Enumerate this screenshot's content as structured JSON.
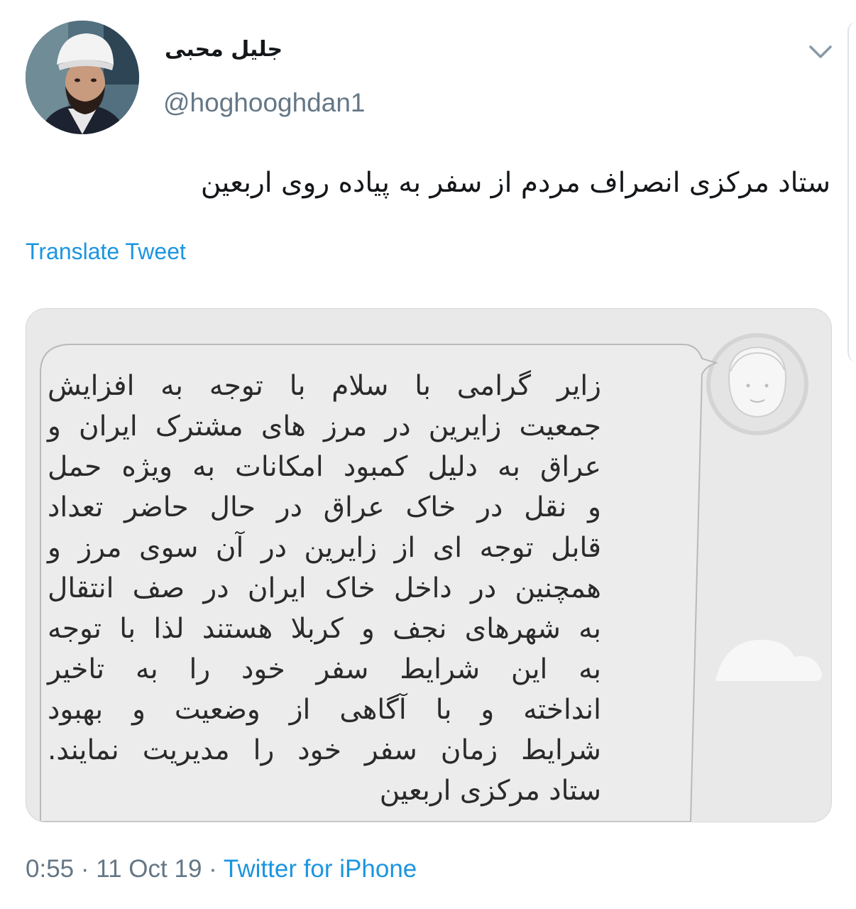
{
  "author": {
    "display_name": "جلیل محبی",
    "handle": "@hoghooghdan1",
    "avatar_icon": "profile-photo"
  },
  "menu_icon": "chevron-down-icon",
  "tweet": {
    "text": "ستاد مرکزی انصراف مردم از سفر به پیاده روی اربعین",
    "translate_label": "Translate Tweet"
  },
  "media": {
    "avatar_icon": "default-user-icon",
    "message_lines": [
      "زایر گرامی با سلام با توجه به افزایش",
      "جمعیت زایرین در مرز های مشترک ایران و",
      "عراق به دلیل کمبود امکانات به ویژه حمل",
      "و نقل در خاک عراق در حال حاضر تعداد",
      "قابل توجه ای از زایرین در آن سوی مرز و",
      "همچنین در داخل خاک ایران در صف انتقال",
      "به شهرهای نجف و کربلا هستند لذا با توجه",
      "به این شرایط سفر خود را به تاخیر",
      "انداخته و با آگاهی از وضعیت و بهبود",
      "شرایط زمان سفر خود را مدیریت نمایند.",
      "ستاد مرکزی اربعین"
    ]
  },
  "footer": {
    "time": "0:55",
    "separator": "·",
    "date": "11 Oct 19",
    "source": "Twitter for iPhone"
  },
  "colors": {
    "link": "#1b95e0",
    "secondary": "#657786",
    "primary_text": "#14171a",
    "card_bg": "#e9e9e9"
  }
}
